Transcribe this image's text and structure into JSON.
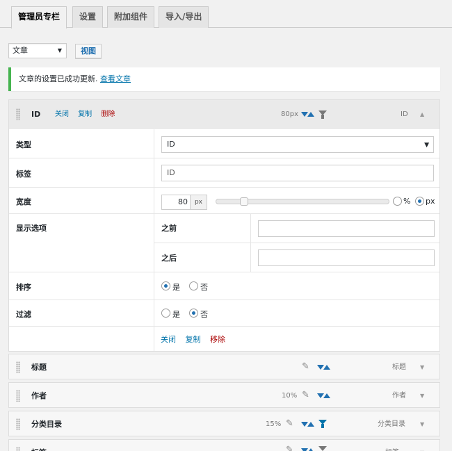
{
  "tabs": [
    "管理员专栏",
    "设置",
    "附加组件",
    "导入/导出"
  ],
  "toolbar": {
    "post_type": "文章",
    "view_label": "视图"
  },
  "notice": {
    "subject": "文章",
    "message": "的设置已成功更新.",
    "link": "查看文章"
  },
  "open_column": {
    "title": "ID",
    "actions": {
      "close": "关闭",
      "copy": "复制",
      "delete": "删除"
    },
    "width_label": "80px",
    "type_label": "ID",
    "toggle": "▲",
    "fields": {
      "type": {
        "label": "类型",
        "value": "ID"
      },
      "label": {
        "label": "标签",
        "value": "ID"
      },
      "width": {
        "label": "宽度",
        "value": "80",
        "unit": "px",
        "fraction": 0.16,
        "opt_percent": "%",
        "opt_px": "px",
        "selected": "px"
      },
      "display": {
        "label": "显示选项",
        "before": "之前",
        "after": "之后",
        "before_value": "",
        "after_value": ""
      },
      "sort": {
        "label": "排序",
        "yes": "是",
        "no": "否",
        "selected": "yes"
      },
      "filter": {
        "label": "过滤",
        "yes": "是",
        "no": "否",
        "selected": "no"
      }
    },
    "footer": {
      "close": "关闭",
      "copy": "复制",
      "remove": "移除"
    }
  },
  "columns": [
    {
      "name": "标题",
      "width": "",
      "type": "标题",
      "filter": false
    },
    {
      "name": "作者",
      "width": "10%",
      "type": "作者",
      "filter": false
    },
    {
      "name": "分类目录",
      "width": "15%",
      "type": "分类目录",
      "filter": true
    },
    {
      "name": "标签",
      "width": "",
      "type": "标签",
      "filter": true
    }
  ],
  "colors": {
    "accent": "#2271b1",
    "danger": "#aa0000",
    "success": "#46b450",
    "filter": "#0073aa",
    "filter_muted": "#777777"
  }
}
